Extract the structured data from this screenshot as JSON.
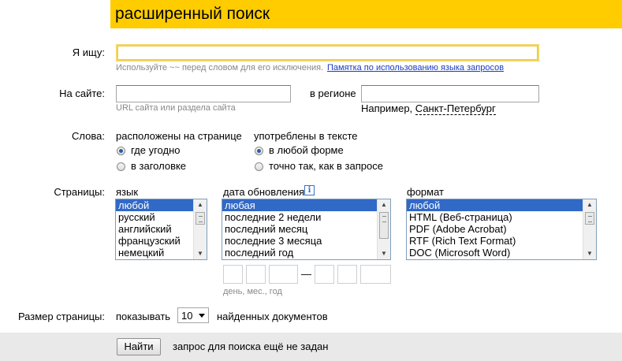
{
  "header": {
    "title": "расширенный поиск",
    "accent_color": "#ffcc00"
  },
  "query": {
    "label": "Я ищу:",
    "value": "",
    "hint": "Используйте ~~ перед словом для его исключения.",
    "hint_link": "Памятка по использованию языка запросов"
  },
  "site": {
    "label": "На сайте:",
    "value": "",
    "hint": "URL сайта или раздела сайта",
    "region_label": "в регионе",
    "region_value": "",
    "example_prefix": "Например,",
    "example_link": "Санкт-Петербург"
  },
  "words": {
    "label": "Слова:",
    "location_header": "расположены на странице",
    "location_options": [
      "где угодно",
      "в заголовке"
    ],
    "location_selected": "где угодно",
    "form_header": "употреблены в тексте",
    "form_options": [
      "в любой форме",
      "точно так, как в запросе"
    ],
    "form_selected": "в любой форме"
  },
  "pages": {
    "label": "Страницы:",
    "language": {
      "header": "язык",
      "items": [
        "любой",
        "русский",
        "английский",
        "французский",
        "немецкий"
      ],
      "selected": "любой"
    },
    "date": {
      "header": "дата обновления",
      "info_icon": "i",
      "items": [
        "любая",
        "последние 2 недели",
        "последний месяц",
        "последние 3 месяца",
        "последний год"
      ],
      "selected": "любая",
      "range_separator": "—",
      "range_hint": "день, мес., год"
    },
    "format": {
      "header": "формат",
      "items": [
        "любой",
        "HTML (Веб-страница)",
        "PDF (Adobe Acrobat)",
        "RTF (Rich Text Format)",
        "DOC (Microsoft Word)"
      ],
      "selected": "любой"
    }
  },
  "page_size": {
    "label": "Размер страницы:",
    "prefix": "показывать",
    "value": "10",
    "suffix": "найденных документов"
  },
  "footer": {
    "button_label": "Найти",
    "status": "запрос для поиска ещё не задан"
  }
}
